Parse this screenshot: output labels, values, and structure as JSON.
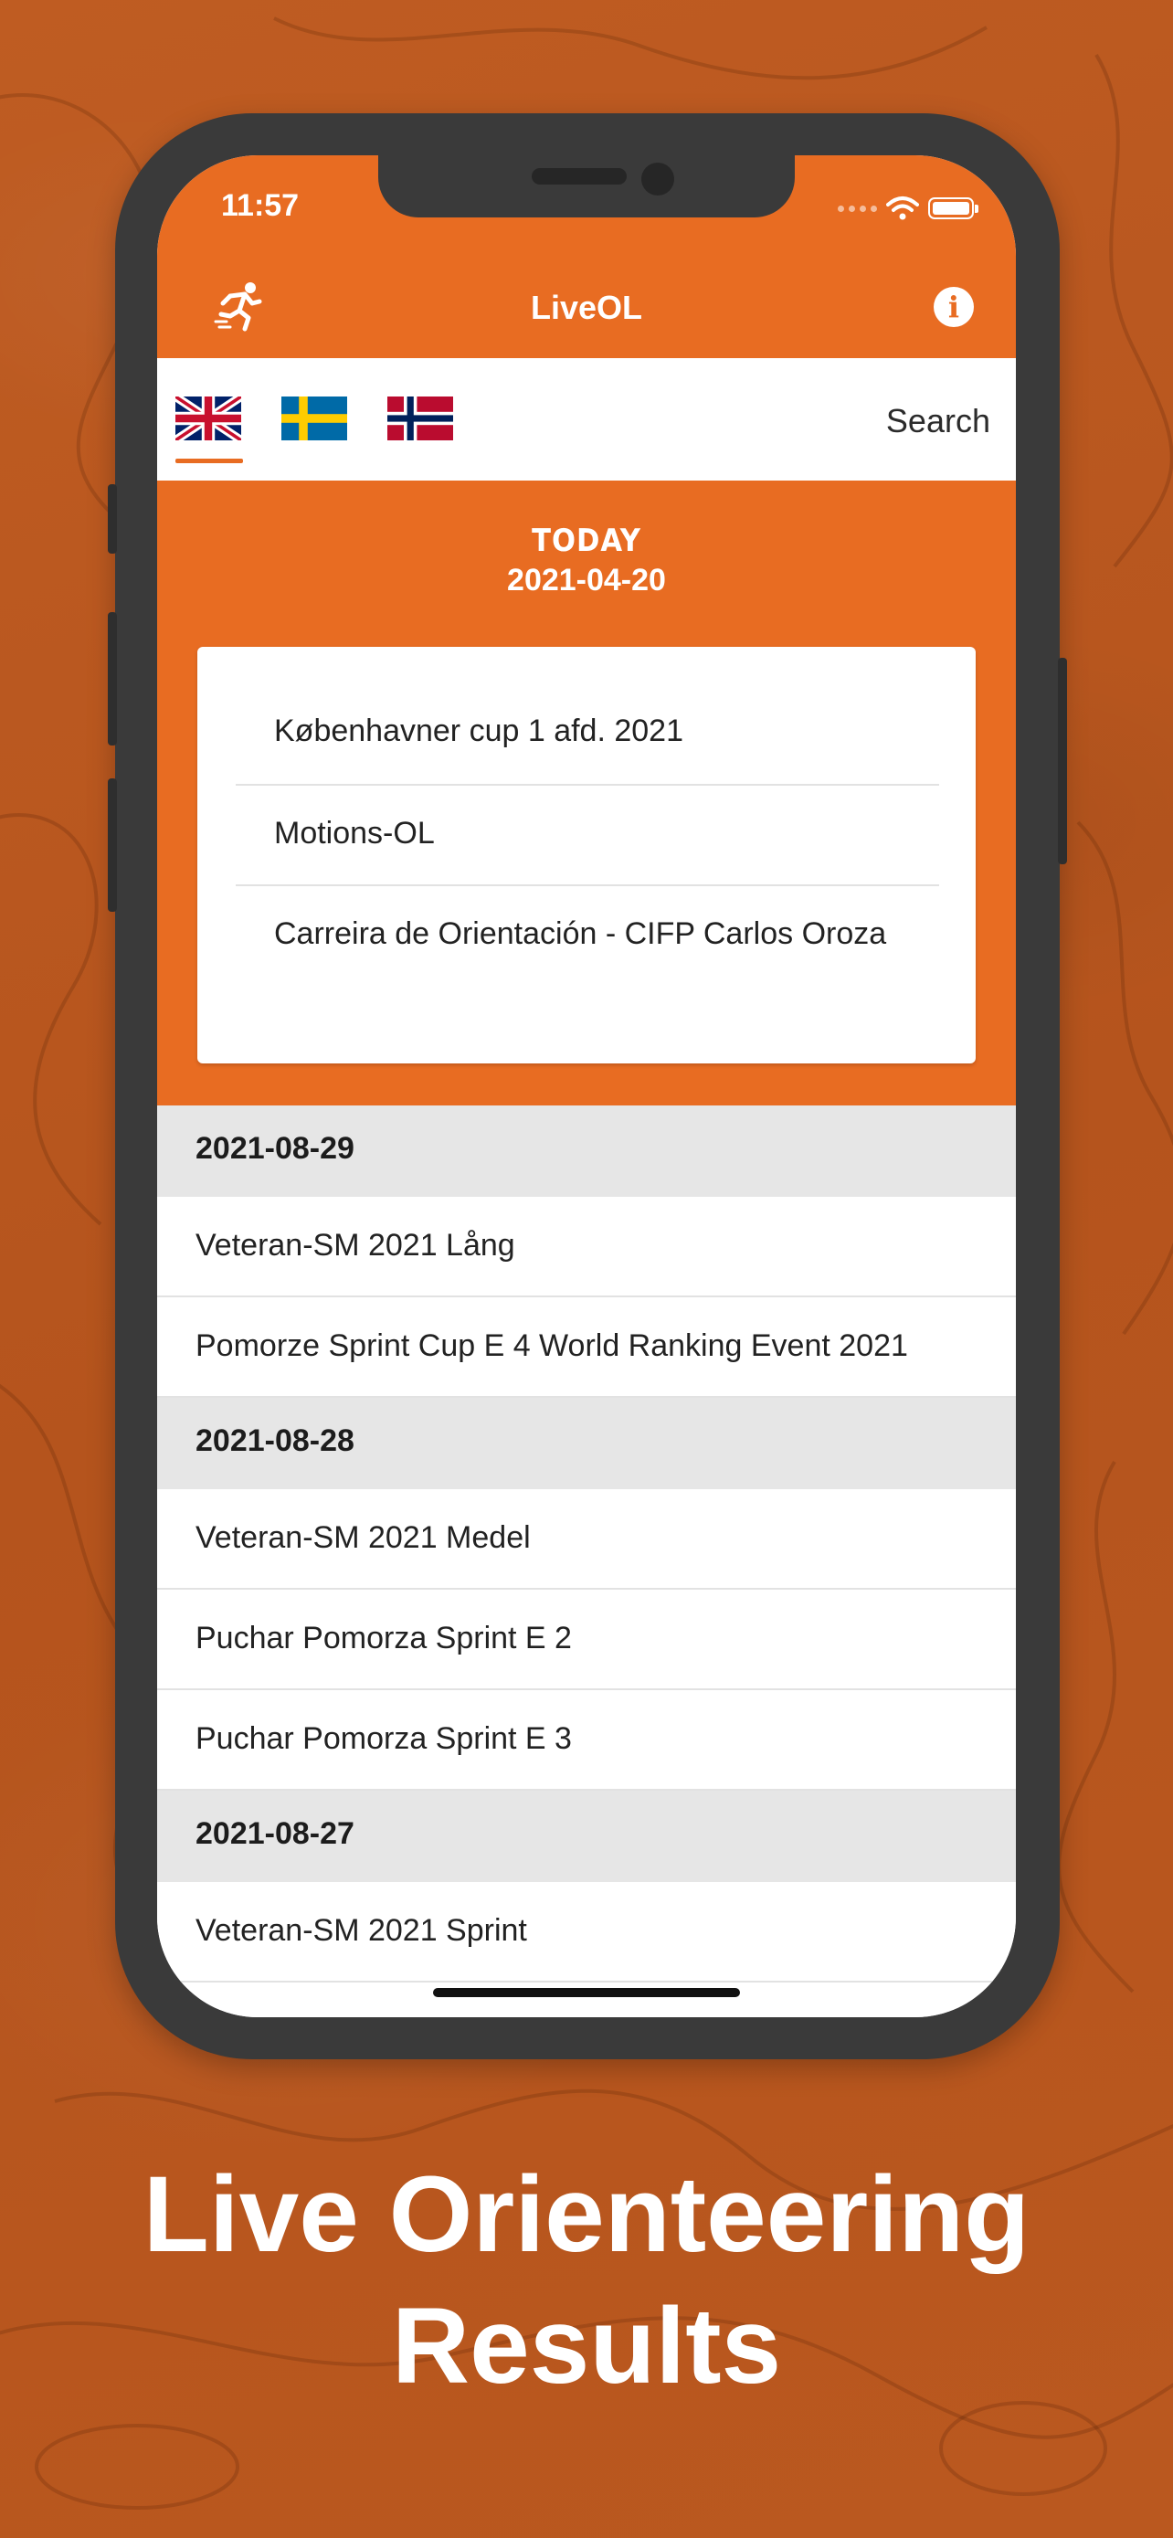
{
  "status_bar": {
    "time": "11:57"
  },
  "nav": {
    "title": "LiveOL",
    "runner_icon": "runner-icon",
    "info_icon": "info-icon"
  },
  "languages": [
    {
      "name": "english-flag",
      "selected": true
    },
    {
      "name": "swedish-flag",
      "selected": false
    },
    {
      "name": "norwegian-flag",
      "selected": false
    }
  ],
  "search": {
    "label": "Search"
  },
  "today": {
    "heading": "TODAY",
    "date": "2021-04-20",
    "events": [
      "Københavner cup 1 afd. 2021",
      "Motions-OL",
      "Carreira de Orientación  - CIFP Carlos Oroza"
    ]
  },
  "groups": [
    {
      "date": "2021-08-29",
      "events": [
        "Veteran-SM 2021 Lång",
        "Pomorze Sprint Cup  E 4 World Ranking Event 2021"
      ]
    },
    {
      "date": "2021-08-28",
      "events": [
        "Veteran-SM 2021 Medel",
        "Puchar Pomorza Sprint E 2",
        "Puchar Pomorza Sprint E 3"
      ]
    },
    {
      "date": "2021-08-27",
      "events": [
        "Veteran-SM 2021 Sprint"
      ]
    }
  ],
  "tagline": {
    "line1": "Live Orienteering",
    "line2": "Results"
  },
  "colors": {
    "accent": "#e86c22",
    "background": "#b8571f",
    "phone_frame": "#3a3a3a",
    "section_header": "#e6e6e6"
  }
}
